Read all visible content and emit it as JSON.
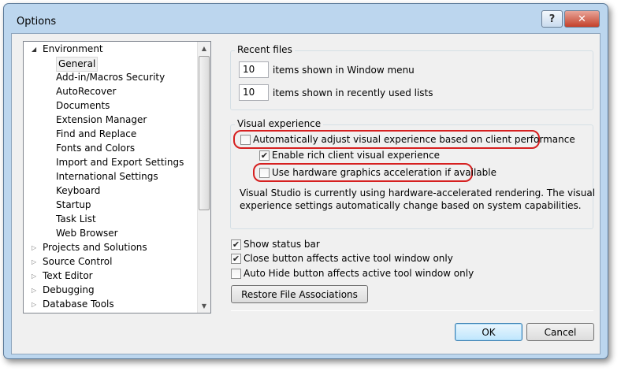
{
  "window": {
    "title": "Options",
    "help_label": "?",
    "close_label": "✕"
  },
  "tree": {
    "items": [
      {
        "label": "Environment",
        "level": 0,
        "state": "expanded"
      },
      {
        "label": "General",
        "level": 1,
        "selected": true
      },
      {
        "label": "Add-in/Macros Security",
        "level": 1
      },
      {
        "label": "AutoRecover",
        "level": 1
      },
      {
        "label": "Documents",
        "level": 1
      },
      {
        "label": "Extension Manager",
        "level": 1
      },
      {
        "label": "Find and Replace",
        "level": 1
      },
      {
        "label": "Fonts and Colors",
        "level": 1
      },
      {
        "label": "Import and Export Settings",
        "level": 1
      },
      {
        "label": "International Settings",
        "level": 1
      },
      {
        "label": "Keyboard",
        "level": 1
      },
      {
        "label": "Startup",
        "level": 1
      },
      {
        "label": "Task List",
        "level": 1
      },
      {
        "label": "Web Browser",
        "level": 1
      },
      {
        "label": "Projects and Solutions",
        "level": 0,
        "state": "collapsed"
      },
      {
        "label": "Source Control",
        "level": 0,
        "state": "collapsed"
      },
      {
        "label": "Text Editor",
        "level": 0,
        "state": "collapsed"
      },
      {
        "label": "Debugging",
        "level": 0,
        "state": "collapsed"
      },
      {
        "label": "Database Tools",
        "level": 0,
        "state": "collapsed"
      }
    ]
  },
  "recent_files": {
    "heading": "Recent files",
    "window_menu_value": "10",
    "window_menu_label": "items shown in Window menu",
    "recent_lists_value": "10",
    "recent_lists_label": "items shown in recently used lists"
  },
  "visual_experience": {
    "heading": "Visual experience",
    "auto_adjust_label": "Automatically adjust visual experience based on client performance",
    "auto_adjust_checked": false,
    "rich_client_label": "Enable rich client visual experience",
    "rich_client_checked": true,
    "hw_accel_label": "Use hardware graphics acceleration if available",
    "hw_accel_checked": false,
    "info_line1": "Visual Studio is currently using hardware-accelerated rendering. The visual",
    "info_line2": "experience settings automatically change based on system capabilities.",
    "highlight_color": "#d62020"
  },
  "options": {
    "status_bar_label": "Show status bar",
    "status_bar_checked": true,
    "close_button_label": "Close button affects active tool window only",
    "close_button_checked": true,
    "auto_hide_label": "Auto Hide button affects active tool window only",
    "auto_hide_checked": false,
    "restore_label": "Restore File Associations"
  },
  "buttons": {
    "ok_label": "OK",
    "cancel_label": "Cancel"
  }
}
